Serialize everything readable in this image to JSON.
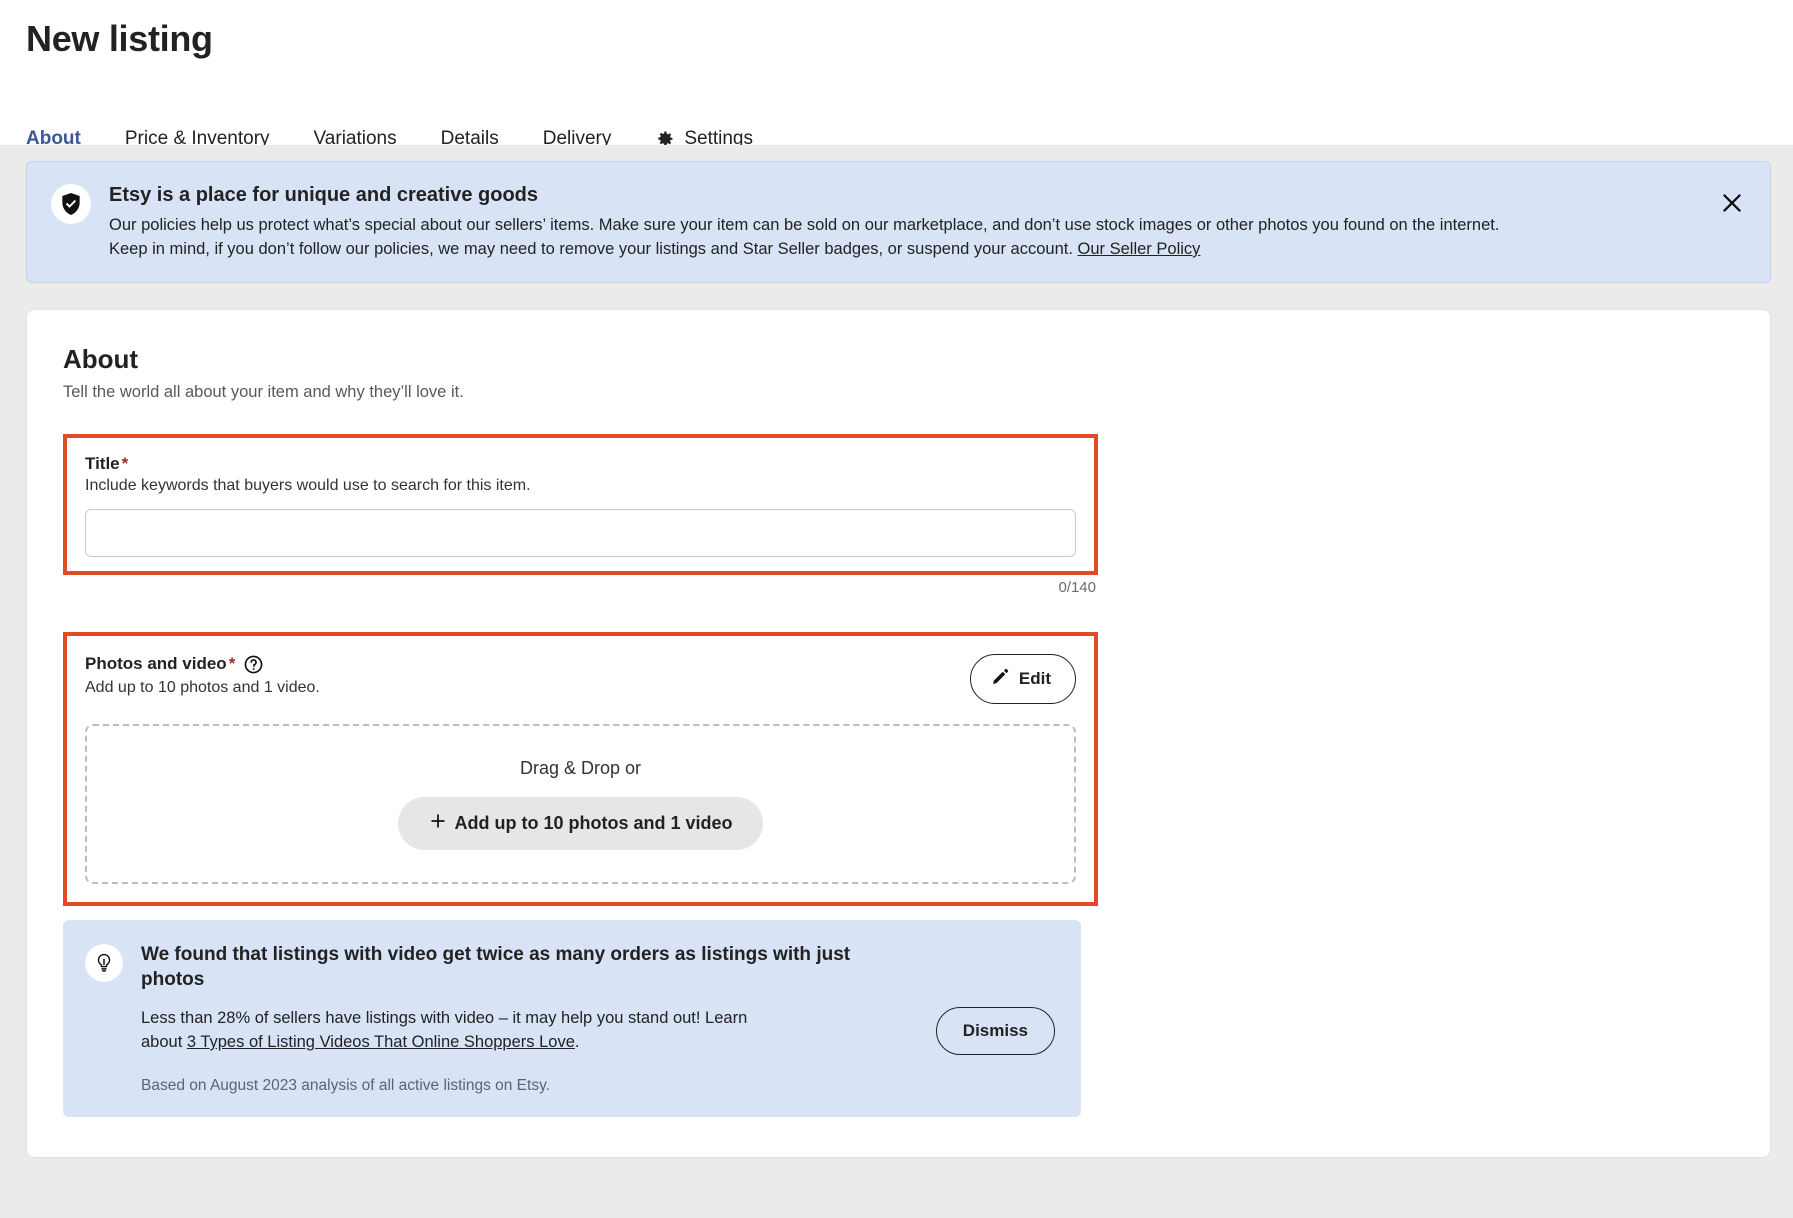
{
  "header": {
    "title": "New listing",
    "tabs": [
      {
        "label": "About",
        "active": true,
        "icon": ""
      },
      {
        "label": "Price & Inventory",
        "active": false,
        "icon": ""
      },
      {
        "label": "Variations",
        "active": false,
        "icon": ""
      },
      {
        "label": "Details",
        "active": false,
        "icon": ""
      },
      {
        "label": "Delivery",
        "active": false,
        "icon": ""
      },
      {
        "label": "Settings",
        "active": false,
        "icon": "gear-icon"
      }
    ]
  },
  "policy_banner": {
    "icon": "shield-check-icon",
    "title": "Etsy is a place for unique and creative goods",
    "body_line1": "Our policies help us protect what’s special about our sellers’ items. Make sure your item can be sold on our marketplace, and don’t use stock images or other photos you found on the internet.",
    "body_line2": "Keep in mind, if you don’t follow our policies, we may need to remove your listings and Star Seller badges, or suspend your account. ",
    "link_label": "Our Seller Policy",
    "close_icon": "close-icon",
    "bg_color": "#d8e3f5"
  },
  "about": {
    "heading": "About",
    "subheading": "Tell the world all about your item and why they’ll love it.",
    "title_field": {
      "label": "Title",
      "required_marker": "*",
      "help": "Include keywords that buyers would use to search for this item.",
      "value": "",
      "placeholder": "",
      "counter": "0/140"
    },
    "photos_field": {
      "label": "Photos and video",
      "required_marker": "*",
      "help_icon": "question-circle-icon",
      "help": "Add up to 10 photos and 1 video.",
      "edit_button": "Edit",
      "edit_icon": "pencil-icon",
      "dropzone_label": "Drag & Drop or",
      "add_button": "Add up to 10 photos and 1 video",
      "add_icon": "plus-icon"
    },
    "video_tip": {
      "icon": "lightbulb-icon",
      "title": "We found that listings with video get twice as many orders as listings with just photos",
      "body_prefix": "Less than 28% of sellers have listings with video – it may help you stand out! Learn about ",
      "body_link": "3 Types of Listing Videos That Online Shoppers Love",
      "body_suffix": ".",
      "footnote": "Based on August 2023 analysis of all active listings on Etsy.",
      "dismiss_button": "Dismiss",
      "bg_color": "#d8e3f5"
    }
  },
  "annotations": {
    "highlight_color": "#e04a25",
    "boxes": [
      "title-field",
      "photos-field"
    ]
  }
}
